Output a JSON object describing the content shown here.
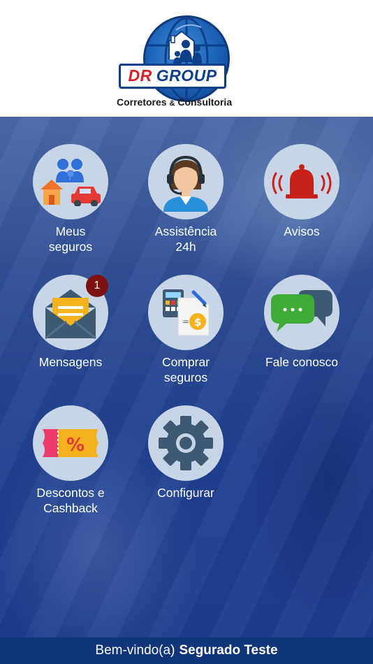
{
  "header": {
    "logo_brand_dr": "DR",
    "logo_brand_group": "GROUP",
    "logo_tagline_a": "Corretores",
    "logo_tagline_amp": "&",
    "logo_tagline_b": "Consultoria"
  },
  "menu": {
    "meus_seguros": {
      "line1": "Meus",
      "line2": "seguros",
      "icon": "family-house-car-icon"
    },
    "assistencia": {
      "line1": "Assistência",
      "line2": "24h",
      "icon": "headset-agent-icon"
    },
    "avisos": {
      "line1": "Avisos",
      "line2": "",
      "icon": "bell-icon"
    },
    "mensagens": {
      "line1": "Mensagens",
      "line2": "",
      "icon": "envelope-icon",
      "badge": "1"
    },
    "comprar": {
      "line1": "Comprar",
      "line2": "seguros",
      "icon": "calculator-document-icon"
    },
    "fale": {
      "line1": "Fale conosco",
      "line2": "",
      "icon": "chat-bubbles-icon"
    },
    "descontos": {
      "line1": "Descontos e",
      "line2": "Cashback",
      "icon": "discount-ticket-icon"
    },
    "configurar": {
      "line1": "Configurar",
      "line2": "",
      "icon": "gear-icon"
    }
  },
  "footer": {
    "greeting": "Bem-vindo(a)",
    "user_name": "Segurado Teste"
  },
  "colors": {
    "footer_bg": "#10357a",
    "badge": "#7e1010",
    "icon_circle": "#c7d5e7"
  }
}
